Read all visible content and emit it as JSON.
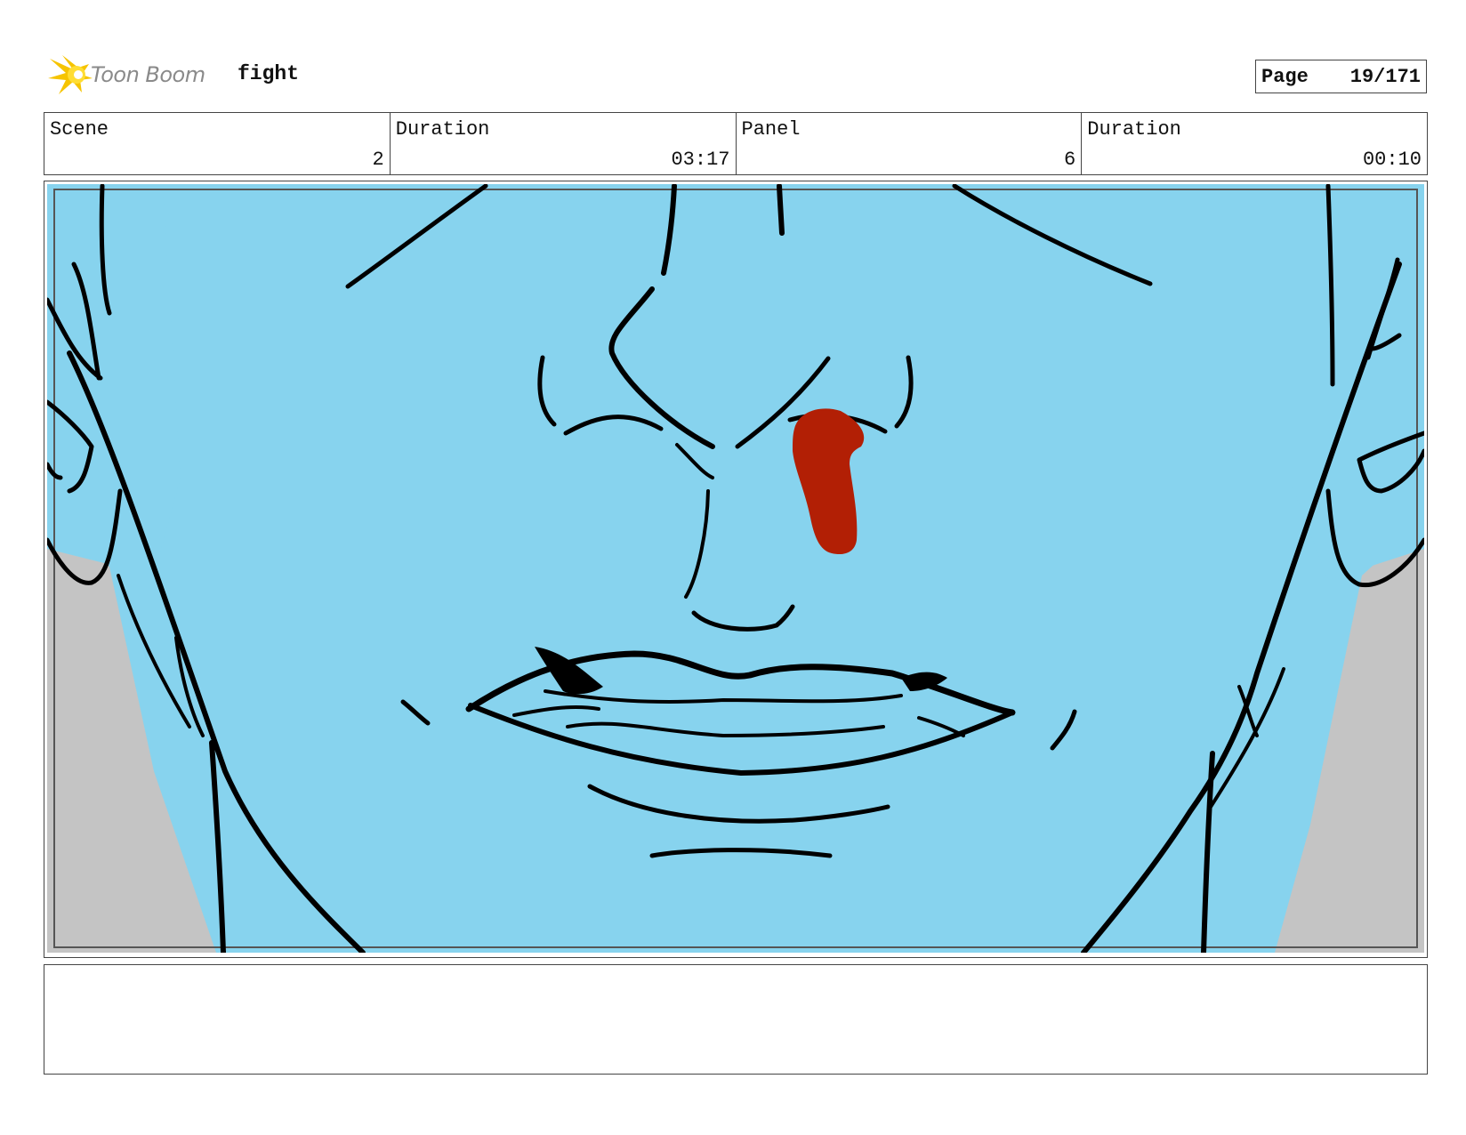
{
  "header": {
    "logo_text": "Toon Boom",
    "project_name": "fight",
    "page_label": "Page",
    "page_value": "19/171"
  },
  "info": {
    "scene_label": "Scene",
    "scene_value": "2",
    "scene_duration_label": "Duration",
    "scene_duration_value": "03:17",
    "panel_label": "Panel",
    "panel_value": "6",
    "panel_duration_label": "Duration",
    "panel_duration_value": "00:10"
  },
  "drawing": {
    "skin_color": "#87D3EE",
    "background_color": "#C4C4C4",
    "blood_color": "#B21F05",
    "line_color": "#000000"
  },
  "notes": {
    "text": ""
  }
}
